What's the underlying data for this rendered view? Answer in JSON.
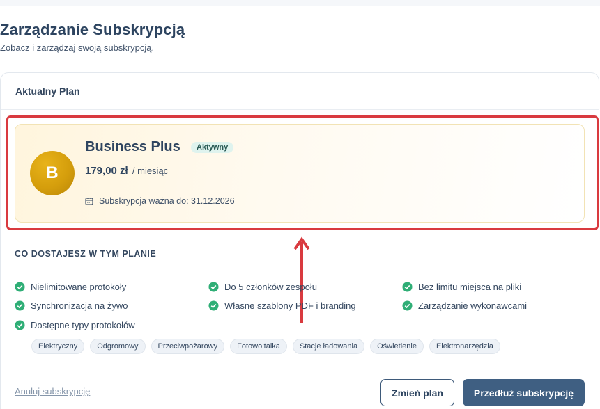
{
  "page": {
    "title": "Zarządzanie Subskrypcją",
    "subtitle": "Zobacz i zarządzaj swoją subskrypcją."
  },
  "current_plan": {
    "section_title": "Aktualny Plan",
    "avatar_letter": "B",
    "name": "Business Plus",
    "status_badge": "Aktywny",
    "price": "179,00 zł",
    "period": "/ miesiąc",
    "valid_until": "Subskrypcja ważna do: 31.12.2026"
  },
  "features": {
    "section_title": "CO DOSTAJESZ W TYM PLANIE",
    "items": [
      "Nielimitowane protokoły",
      "Do 5 członków zespołu",
      "Bez limitu miejsca na pliki",
      "Synchronizacja na żywo",
      "Własne szablony PDF i branding",
      "Zarządzanie wykonawcami",
      "Dostępne typy protokołów"
    ],
    "protocol_types": [
      "Elektryczny",
      "Odgromowy",
      "Przeciwpożarowy",
      "Fotowoltaika",
      "Stacje ładowania",
      "Oświetlenie",
      "Elektronarzędzia"
    ]
  },
  "actions": {
    "cancel_label": "Anuluj subskrypcję",
    "change_plan_label": "Zmień plan",
    "renew_label": "Przedłuż subskrypcję"
  },
  "colors": {
    "accent": "#3f5f82",
    "success": "#2fae76",
    "gold": "#d59e0c",
    "highlight": "#d93a3f"
  },
  "icons": {
    "calendar": "calendar-icon",
    "check": "check-circle-icon",
    "arrow": "arrow-up-icon"
  }
}
